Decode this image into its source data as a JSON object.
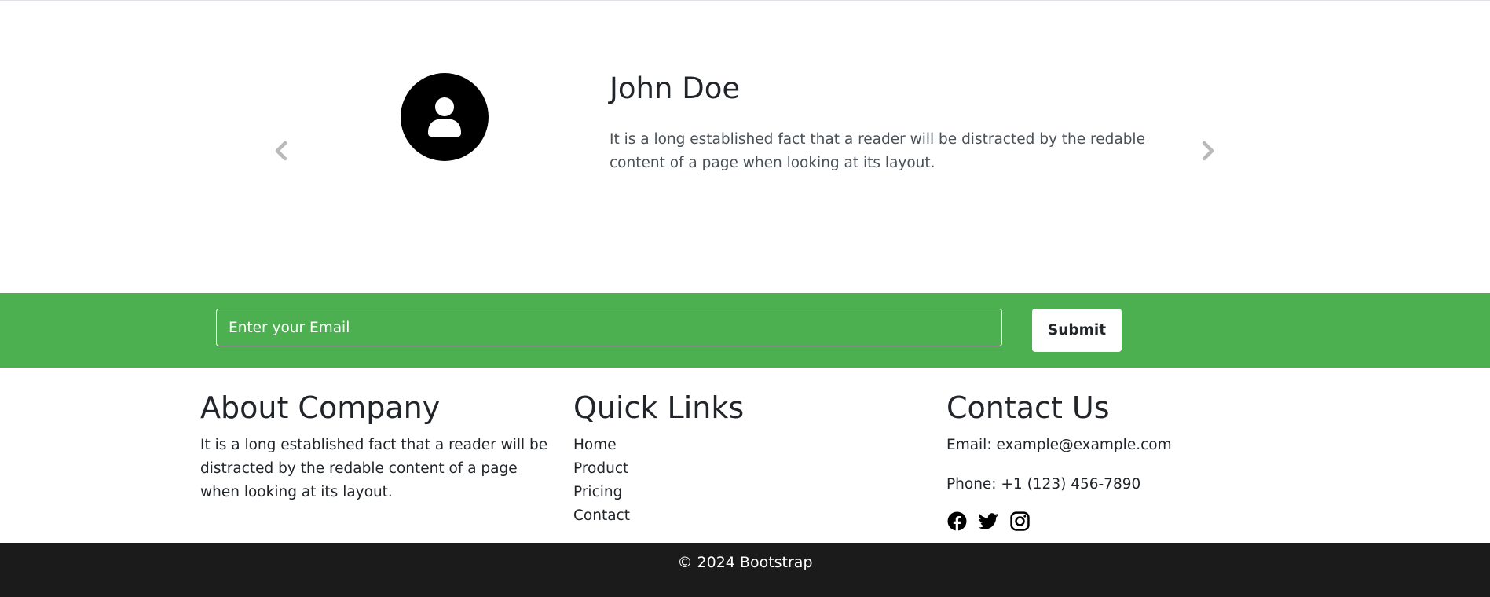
{
  "testimonial": {
    "name": "John Doe",
    "text": "It is a long established fact that a reader will be distracted by the redable content of a page when looking at its layout."
  },
  "newsletter": {
    "email_placeholder": "Enter your Email",
    "submit_label": "Submit",
    "background_color": "#4caf50"
  },
  "footer": {
    "about": {
      "heading": "About Company",
      "text": "It is a long established fact that a reader will be distracted by the redable content of a page when looking at its layout."
    },
    "quick_links": {
      "heading": "Quick Links",
      "items": [
        "Home",
        "Product",
        "Pricing",
        "Contact"
      ]
    },
    "contact": {
      "heading": "Contact Us",
      "email": "Email: example@example.com",
      "phone": "Phone: +1 (123) 456-7890",
      "social_icons": [
        "facebook-icon",
        "twitter-icon",
        "instagram-icon"
      ]
    }
  },
  "bottom_bar": {
    "copyright": "© 2024 Bootstrap",
    "background_color": "#1b1b1b"
  }
}
